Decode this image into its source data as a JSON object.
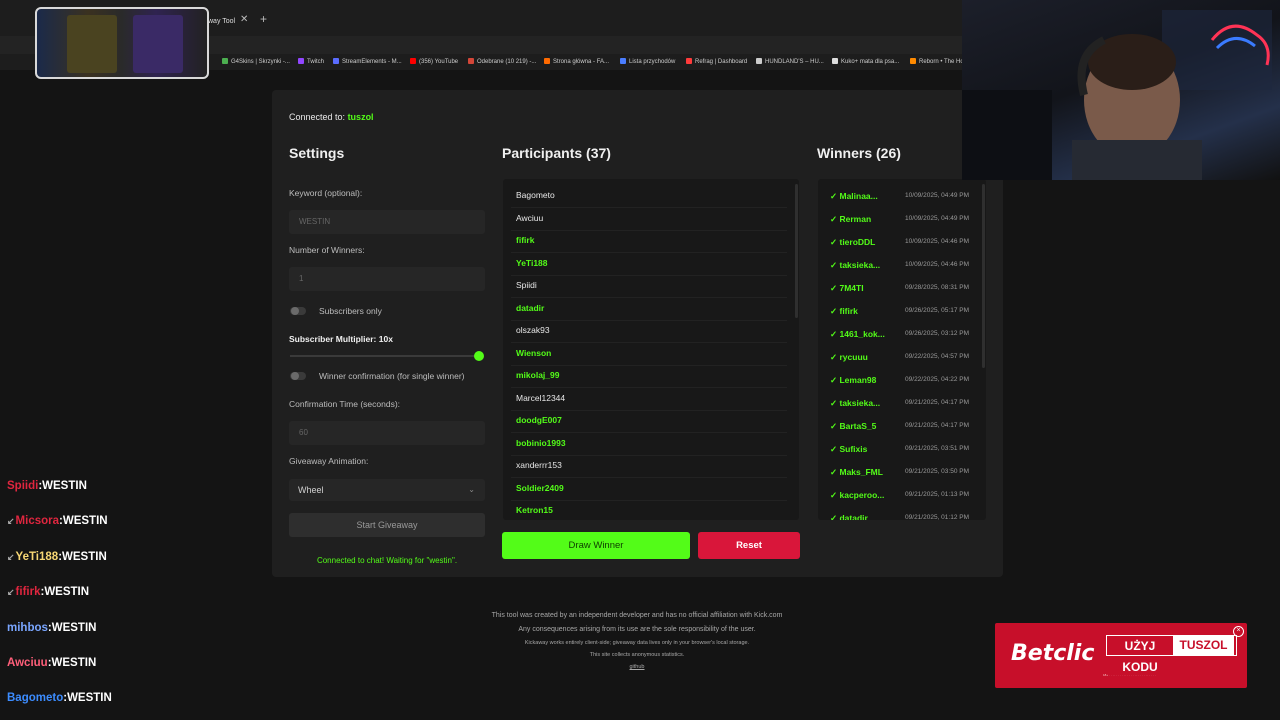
{
  "browser": {
    "active_tab_label": "way Tool",
    "bookmarks": [
      "G4Skins | Skrzynki -...",
      "Twitch",
      "StreamElements - M...",
      "(356) YouTube",
      "Odebrane (10 219) -...",
      "Strona główna - FA...",
      "Lista przychodów",
      "Refrag | Dashboard",
      "HUNDLAND'S – HU...",
      "Kuko+ mata dla psa...",
      "Reborn • The Ho"
    ]
  },
  "connection": {
    "label": "Connected to:",
    "channel": "tuszol"
  },
  "settings": {
    "heading": "Settings",
    "keyword_label": "Keyword (optional):",
    "keyword_value": "WESTIN",
    "winners_label": "Number of Winners:",
    "winners_value": "1",
    "subscribers_only_label": "Subscribers only",
    "subscribers_only": false,
    "multiplier_label": "Subscriber Multiplier: 10x",
    "multiplier_value": 10,
    "winner_confirmation_label": "Winner confirmation (for single winner)",
    "winner_confirmation": false,
    "confirmation_time_label": "Confirmation Time (seconds):",
    "confirmation_time_value": "60",
    "animation_label": "Giveaway Animation:",
    "animation_value": "Wheel",
    "start_button": "Start Giveaway",
    "status_text": "Connected to chat! Waiting for \"westin\"."
  },
  "participants": {
    "heading": "Participants (37)",
    "items": [
      {
        "name": "Bagometo",
        "subscriber": false
      },
      {
        "name": "Awciuu",
        "subscriber": false
      },
      {
        "name": "fifirk",
        "subscriber": true
      },
      {
        "name": "YeTi188",
        "subscriber": true
      },
      {
        "name": "Spiidi",
        "subscriber": false
      },
      {
        "name": "datadir",
        "subscriber": true
      },
      {
        "name": "olszak93",
        "subscriber": false
      },
      {
        "name": "Wienson",
        "subscriber": true
      },
      {
        "name": "mikolaj_99",
        "subscriber": true
      },
      {
        "name": "Marcel12344",
        "subscriber": false
      },
      {
        "name": "doodgE007",
        "subscriber": true
      },
      {
        "name": "bobinio1993",
        "subscriber": true
      },
      {
        "name": "xanderrr153",
        "subscriber": false
      },
      {
        "name": "Soldier2409",
        "subscriber": true
      },
      {
        "name": "Ketron15",
        "subscriber": true
      }
    ],
    "draw_button": "Draw Winner",
    "reset_button": "Reset"
  },
  "winners": {
    "heading": "Winners (26)",
    "items": [
      {
        "name": "Malinaa...",
        "date": "10/09/2025, 04:49 PM"
      },
      {
        "name": "Rerman",
        "date": "10/09/2025, 04:49 PM"
      },
      {
        "name": "tieroDDL",
        "date": "10/09/2025, 04:46 PM"
      },
      {
        "name": "taksieka...",
        "date": "10/09/2025, 04:46 PM"
      },
      {
        "name": "7M4TI",
        "date": "09/28/2025, 08:31 PM"
      },
      {
        "name": "fifirk",
        "date": "09/26/2025, 05:17 PM"
      },
      {
        "name": "1461_kok...",
        "date": "09/26/2025, 03:12 PM"
      },
      {
        "name": "rycuuu",
        "date": "09/22/2025, 04:57 PM"
      },
      {
        "name": "Leman98",
        "date": "09/22/2025, 04:22 PM"
      },
      {
        "name": "taksieka...",
        "date": "09/21/2025, 04:17 PM"
      },
      {
        "name": "BartaS_5",
        "date": "09/21/2025, 04:17 PM"
      },
      {
        "name": "Sufixis",
        "date": "09/21/2025, 03:51 PM"
      },
      {
        "name": "Maks_FML",
        "date": "09/21/2025, 03:50 PM"
      },
      {
        "name": "kacperoo...",
        "date": "09/21/2025, 01:13 PM"
      },
      {
        "name": "datadir",
        "date": "09/21/2025, 01:12 PM"
      }
    ]
  },
  "footer": [
    "This tool was created by an independent developer and has no official affiliation with Kick.com",
    "Any consequences arising from its use are the sole responsibility of the user.",
    "Kickaway works entirely client-side; giveaway data lives only in your browser's local storage.",
    "This site collects anonymous statistics.",
    "github"
  ],
  "chat": [
    {
      "user": "Spiidi",
      "message": "WESTIN",
      "color": "#e0263f",
      "prefix": ""
    },
    {
      "user": "Micsora",
      "message": "WESTIN",
      "color": "#e0263f",
      "prefix": "↙"
    },
    {
      "user": "YeTi188",
      "message": "WESTIN",
      "color": "#f7d774",
      "prefix": "↙"
    },
    {
      "user": "fifirk",
      "message": "WESTIN",
      "color": "#e0263f",
      "prefix": "↙"
    },
    {
      "user": "mihbos",
      "message": "WESTIN",
      "color": "#7aa6ff",
      "prefix": ""
    },
    {
      "user": "Awciuu",
      "message": "WESTIN",
      "color": "#ff5f7a",
      "prefix": ""
    },
    {
      "user": "Bagometo",
      "message": "WESTIN",
      "color": "#3c8cff",
      "prefix": ""
    }
  ],
  "ad": {
    "brand": "Betclic",
    "cta": "UŻYJ KODU",
    "code": "TUSZOL"
  },
  "colors": {
    "kick_green": "#53fc18",
    "reset_red": "#d9163a",
    "panel_bg": "#1f1f1f"
  }
}
